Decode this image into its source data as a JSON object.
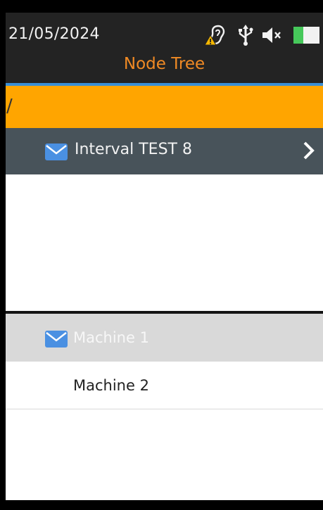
{
  "status_bar": {
    "date": "21/05/2024",
    "icons": [
      "hearing-warning-icon",
      "usb-icon",
      "speaker-muted-icon",
      "battery-icon"
    ]
  },
  "header": {
    "title": "Node Tree"
  },
  "path": {
    "text": "/"
  },
  "folder": {
    "label": "Interval TEST 8",
    "icon": "mail-icon",
    "chevron": "chevron-right-icon"
  },
  "nodes": [
    {
      "label": "Machine 1",
      "selected": true,
      "icon": "mail-icon"
    },
    {
      "label": "Machine 2",
      "selected": false
    }
  ],
  "colors": {
    "accent_orange": "#ffa500",
    "title_orange": "#f08a24",
    "header_bg": "#232323",
    "folder_row_bg": "#48535a",
    "selected_row_bg": "#d9d9d9",
    "mail_blue": "#4a90e2"
  }
}
